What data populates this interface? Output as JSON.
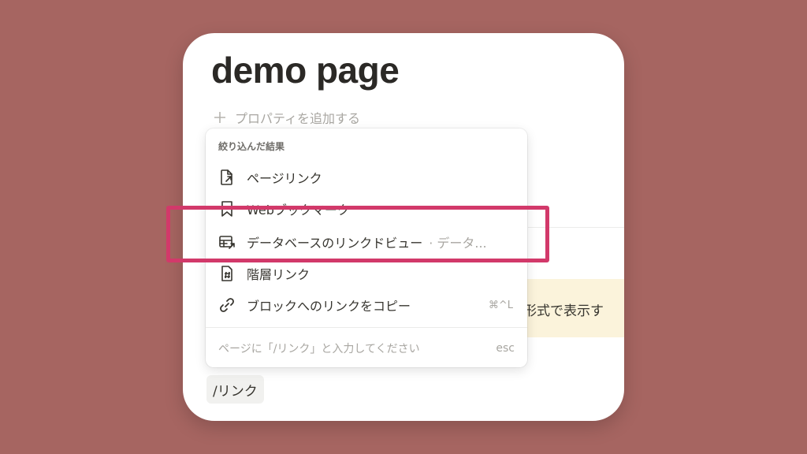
{
  "page": {
    "title": "demo page",
    "add_property_label": "プロパティを追加する",
    "callout_text": "形式で表示す",
    "slash_query": "/リンク"
  },
  "menu": {
    "header": "絞り込んだ結果",
    "items": [
      {
        "icon": "page-link-icon",
        "label": "ページリンク"
      },
      {
        "icon": "bookmark-icon",
        "label": "Webブックマーク"
      },
      {
        "icon": "database-link-icon",
        "label": "データベースのリンクドビュー",
        "sub": "· データ..."
      },
      {
        "icon": "breadcrumb-icon",
        "label": "階層リンク"
      },
      {
        "icon": "link-icon",
        "label": "ブロックへのリンクをコピー",
        "shortcut": "⌘^L"
      }
    ],
    "footer_hint": "ページに「/リンク」と入力してください",
    "footer_esc": "esc"
  },
  "colors": {
    "background": "#a66561",
    "highlight": "#d2396a",
    "callout_bg": "#fbf3db"
  }
}
